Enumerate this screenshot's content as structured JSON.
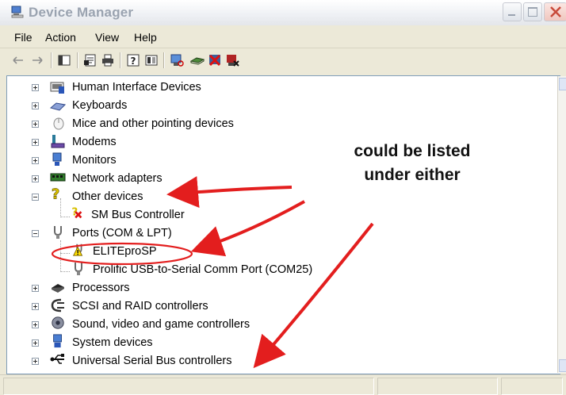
{
  "window": {
    "title": "Device Manager",
    "icons": {
      "app": "computer-monitor-icon",
      "minimize": "minimize-icon",
      "maximize": "maximize-icon",
      "close": "close-icon"
    }
  },
  "menubar": {
    "items": [
      {
        "label": "File"
      },
      {
        "label": "Action"
      },
      {
        "label": "View"
      },
      {
        "label": "Help"
      }
    ]
  },
  "toolbar": {
    "buttons": [
      "back-arrow-icon",
      "forward-arrow-icon",
      "show-hide-console-tree-icon",
      "properties-icon",
      "print-icon",
      "help-icon",
      "view-icon",
      "scan-hardware-icon",
      "update-driver-icon",
      "disable-device-icon",
      "uninstall-device-icon"
    ]
  },
  "tree": {
    "items": [
      {
        "label": "Human Interface Devices",
        "expanded": false,
        "icon": "hid-keyboard-icon"
      },
      {
        "label": "Keyboards",
        "expanded": false,
        "icon": "keyboard-icon"
      },
      {
        "label": "Mice and other pointing devices",
        "expanded": false,
        "icon": "mouse-icon"
      },
      {
        "label": "Modems",
        "expanded": false,
        "icon": "modem-icon"
      },
      {
        "label": "Monitors",
        "expanded": false,
        "icon": "monitor-icon"
      },
      {
        "label": "Network adapters",
        "expanded": false,
        "icon": "network-card-icon"
      },
      {
        "label": "Other devices",
        "expanded": true,
        "icon": "question-mark-icon",
        "children": [
          {
            "label": "SM Bus Controller",
            "icon": "error-device-icon"
          }
        ]
      },
      {
        "label": "Ports (COM & LPT)",
        "expanded": true,
        "icon": "port-connector-icon",
        "children": [
          {
            "label": "ELITEproSP",
            "icon": "warning-device-icon"
          },
          {
            "label": "Prolific USB-to-Serial Comm Port (COM25)",
            "icon": "port-connector-icon"
          }
        ]
      },
      {
        "label": "Processors",
        "expanded": false,
        "icon": "processor-chip-icon"
      },
      {
        "label": "SCSI and RAID controllers",
        "expanded": false,
        "icon": "scsi-icon"
      },
      {
        "label": "Sound, video and game controllers",
        "expanded": false,
        "icon": "speaker-icon"
      },
      {
        "label": "System devices",
        "expanded": false,
        "icon": "system-device-icon"
      },
      {
        "label": "Universal Serial Bus controllers",
        "expanded": false,
        "icon": "usb-icon"
      }
    ]
  },
  "annotation": {
    "line1": "could be listed",
    "line2": "under either",
    "arrow_color": "#e31e1e",
    "circle_color": "#e31e1e"
  },
  "colors": {
    "window_bg": "#ece9d8",
    "tree_bg": "#ffffff",
    "tree_border": "#7f9db9"
  }
}
